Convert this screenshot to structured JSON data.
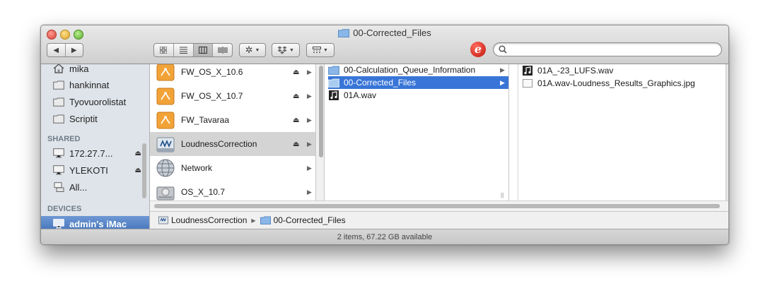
{
  "window": {
    "title": "00-Corrected_Files"
  },
  "toolbar": {
    "view_icons": "icon-view-icon",
    "view_list": "list-view-icon",
    "view_columns": "column-view-icon",
    "view_coverflow": "coverflow-view-icon",
    "action_icon": "gear-icon",
    "dropbox_icon": "dropbox-icon",
    "arrange_icon": "arrange-icon",
    "search_placeholder": ""
  },
  "sidebar": {
    "places": [
      "mika",
      "hankinnat",
      "Tyovuorolistat",
      "Scriptit"
    ],
    "shared_header": "SHARED",
    "shared": [
      "172.27.7...",
      "YLEKOTI",
      "All..."
    ],
    "devices_header": "DEVICES",
    "devices": [
      "admin's iMac"
    ]
  },
  "column1": {
    "items": [
      "FW_OS_X_10.6",
      "FW_OS_X_10.7",
      "FW_Tavaraa",
      "LoudnessCorrection",
      "Network",
      "OS_X_10.7"
    ],
    "selected": "LoudnessCorrection"
  },
  "column2": {
    "items": [
      "00-Calculation_Queue_Information",
      "00-Corrected_Files",
      "01A.wav"
    ],
    "selected": "00-Corrected_Files"
  },
  "column3": {
    "items": [
      "01A_-23_LUFS.wav",
      "01A.wav-Loudness_Results_Graphics.jpg"
    ]
  },
  "pathbar": {
    "segments": [
      "LoudnessCorrection",
      "00-Corrected_Files"
    ]
  },
  "status": {
    "text": "2 items, 67.22 GB available"
  },
  "colors": {
    "selection": "#3875d7",
    "sidebar_selection": "#4a7bc2",
    "sidebar_bg": "#dfe4ea"
  }
}
